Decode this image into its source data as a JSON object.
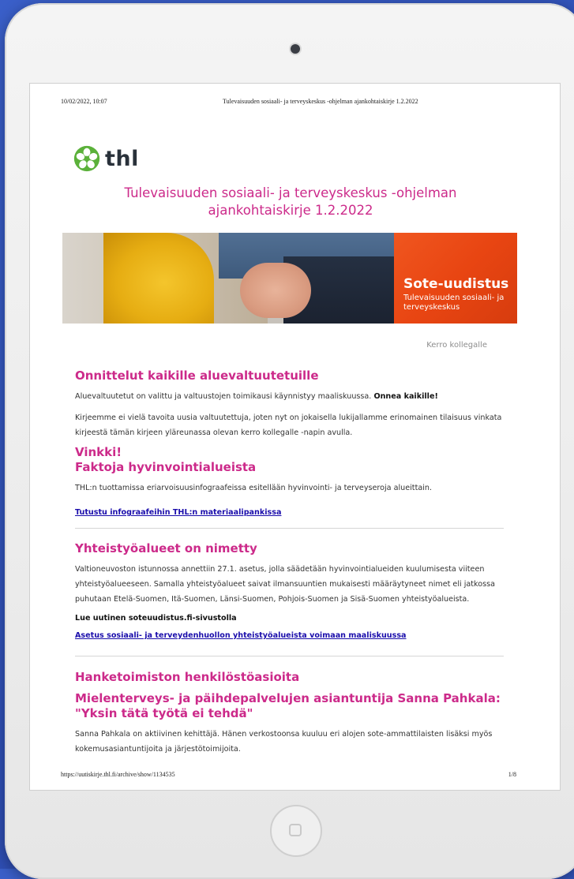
{
  "print_header": {
    "date": "10/02/2022, 10:07",
    "title": "Tulevaisuuden sosiaali- ja terveyskeskus -ohjelman ajankohtaiskirje 1.2.2022"
  },
  "print_footer": {
    "url": "https://uutiskirje.thl.fi/archive/show/1134535",
    "page": "1/8"
  },
  "logo": {
    "text": "thl",
    "icon": "thl-flower-icon",
    "color": "#5bb13a"
  },
  "newsletter_title": "Tulevaisuuden sosiaali- ja terveyskeskus -ohjelman ajankohtaiskirje 1.2.2022",
  "banner": {
    "title": "Sote-uudistus",
    "subtitle": "Tulevaisuuden sosiaali- ja terveyskeskus"
  },
  "share_link": "Kerro kollegalle",
  "section1": {
    "heading": "Onnittelut kaikille aluevaltuutetuille",
    "p1_text": "Aluevaltuutetut on valittu ja valtuustojen toimikausi käynnistyy maaliskuussa.",
    "p1_bold": "Onnea kaikille!",
    "p2": "Kirjeemme ei vielä tavoita uusia valtuutettuja, joten nyt on jokaisella lukijallamme erinomainen tilaisuus vinkata kirjeestä tämän kirjeen yläreunassa olevan kerro kollegalle -napin avulla.",
    "sub_heading_1": "Vinkki!",
    "sub_heading_2": "Faktoja hyvinvointialueista",
    "p3": "THL:n tuottamissa eriarvoisuusinfograafeissa esitellään hyvinvointi- ja terveyseroja alueittain.",
    "link": "Tutustu infograafeihin THL:n materiaalipankissa"
  },
  "section2": {
    "heading": "Yhteistyöalueet on nimetty",
    "p1": "Valtioneuvoston istunnossa annettiin 27.1. asetus, jolla säädetään hyvinvointialueiden kuulumisesta viiteen yhteistyöalueeseen. Samalla yhteistyöalueet saivat ilmansuuntien mukaisesti määräytyneet nimet eli jatkossa puhutaan Etelä-Suomen, Itä-Suomen, Länsi-Suomen, Pohjois-Suomen ja Sisä-Suomen yhteistyöalueista.",
    "lead": "Lue uutinen soteuudistus.fi-sivustolla",
    "link": "Asetus sosiaali- ja terveydenhuollon yhteistyöalueista voimaan maaliskuussa"
  },
  "section3": {
    "heading": "Hanketoimiston henkilöstöasioita",
    "sub_heading": "Mielenterveys- ja päihdepalvelujen asiantuntija Sanna Pahkala: \"Yksin tätä työtä ei tehdä\"",
    "p1": "Sanna Pahkala on aktiivinen kehittäjä. Hänen verkostoonsa kuuluu eri alojen sote-ammattilaisten lisäksi myös kokemusasiantuntijoita ja järjestötoimijoita."
  }
}
